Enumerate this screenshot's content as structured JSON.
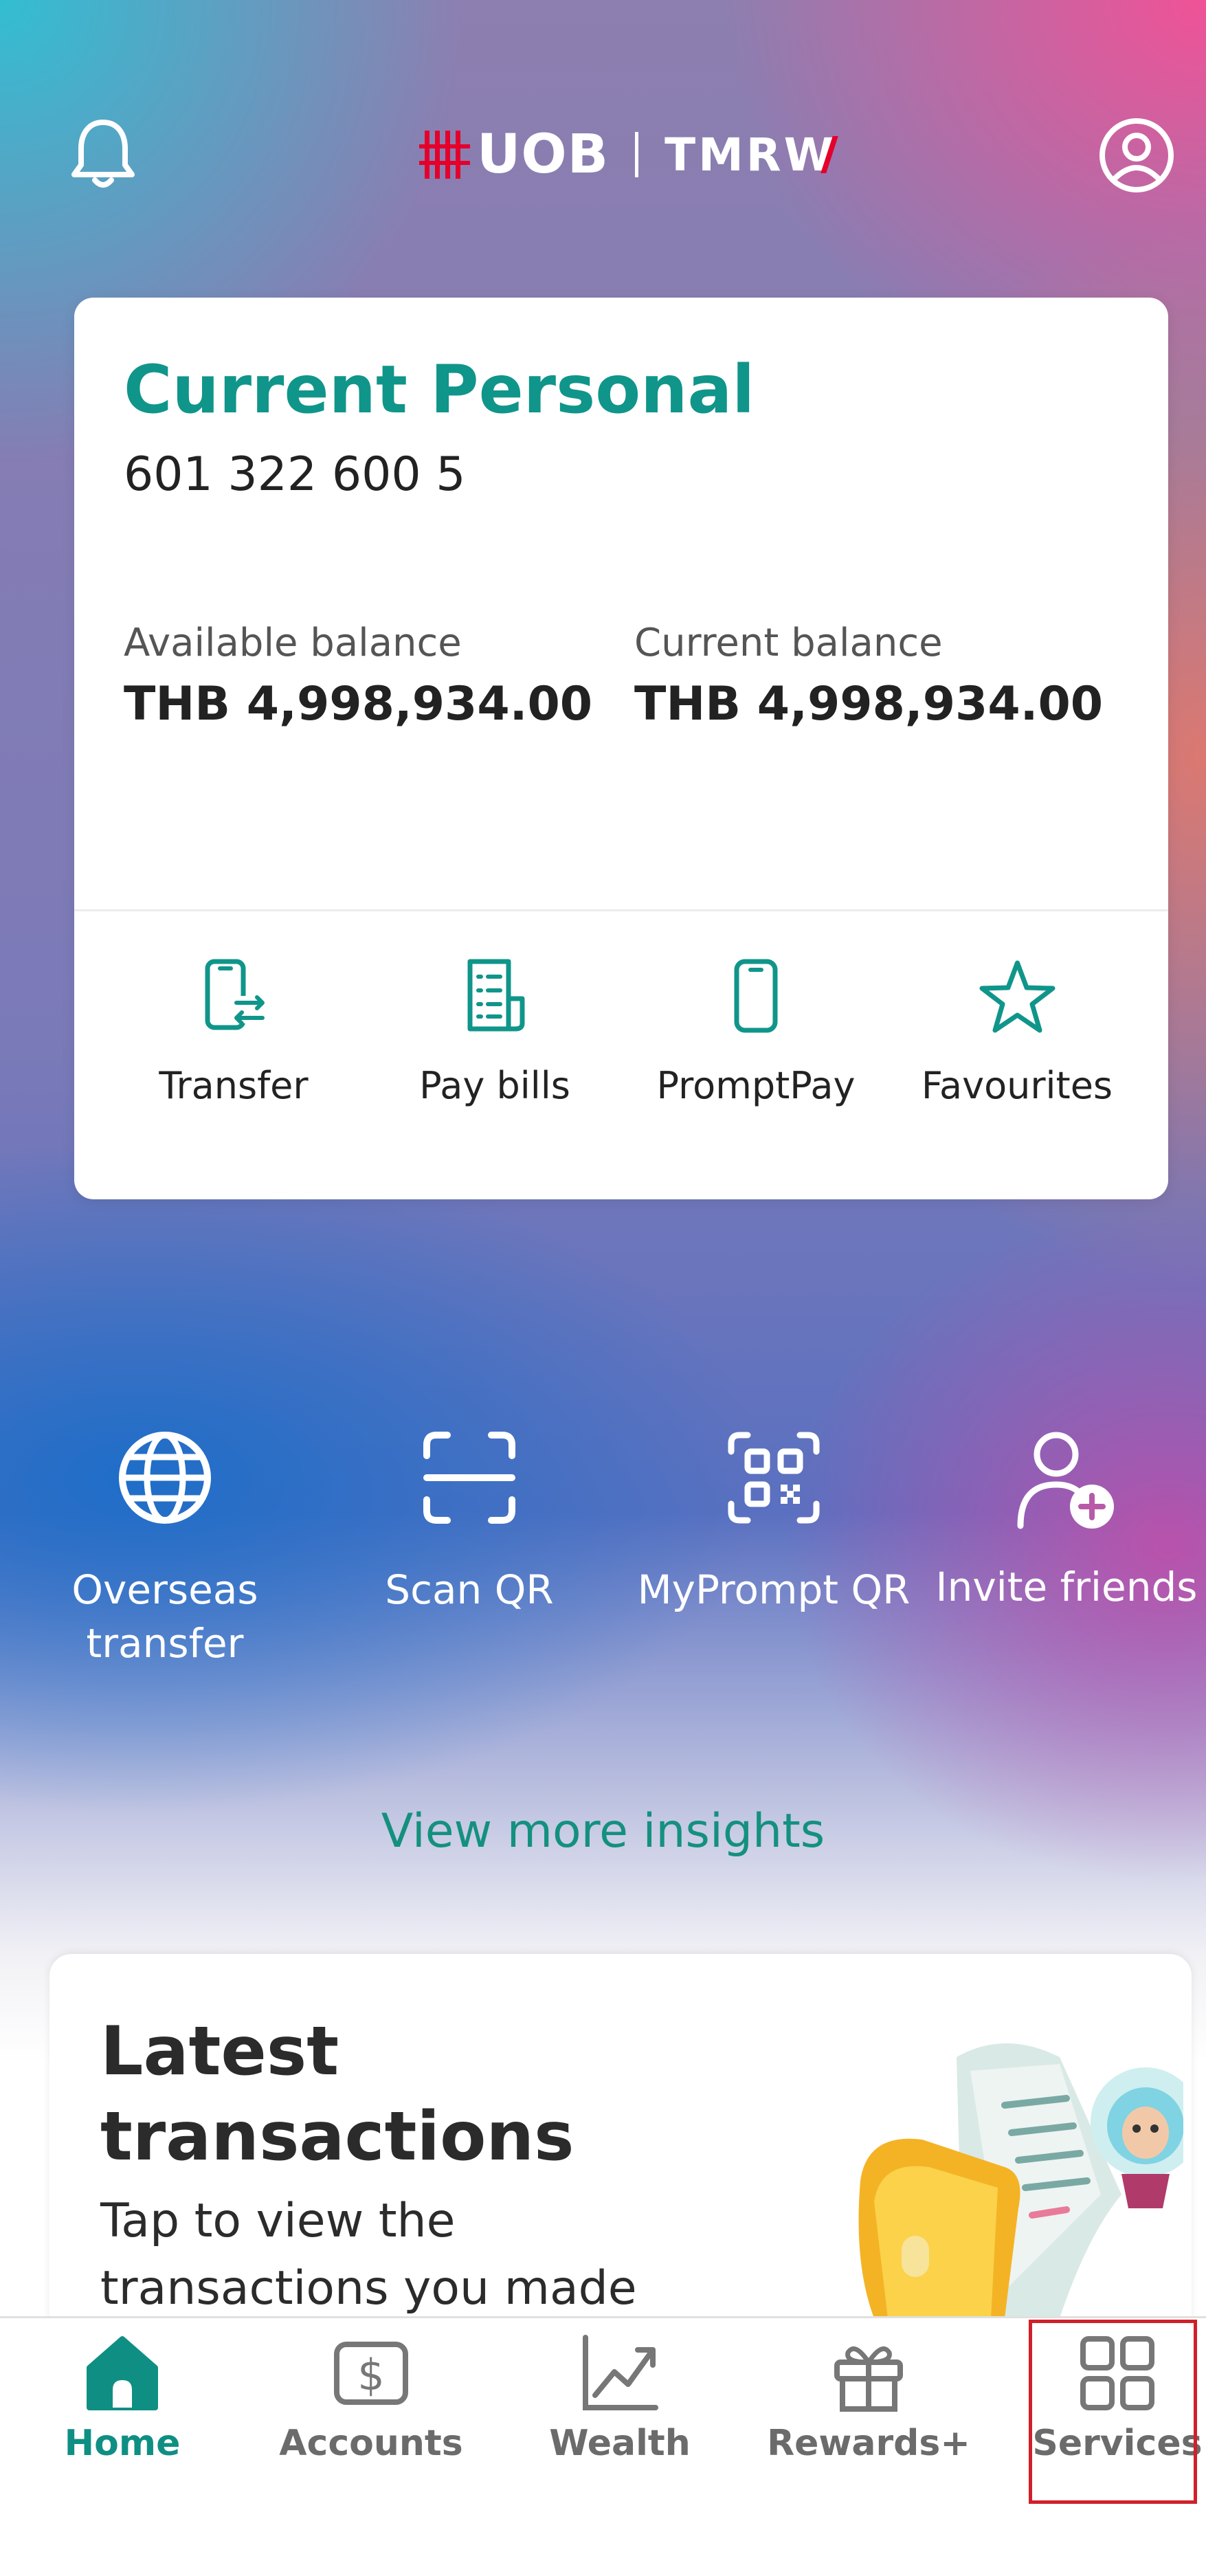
{
  "header": {
    "brand_primary": "UOB",
    "brand_secondary": "TMRW",
    "icons": [
      "bell-icon",
      "profile-icon"
    ]
  },
  "account_card": {
    "title": "Current Personal",
    "account_number": "601 322 600 5",
    "available_label": "Available balance",
    "available_value": "THB 4,998,934.00",
    "current_label": "Current balance",
    "current_value": "THB 4,998,934.00",
    "actions": [
      {
        "label": "Transfer",
        "icon": "phone-transfer-icon"
      },
      {
        "label": "Pay bills",
        "icon": "receipt-icon"
      },
      {
        "label": "PromptPay",
        "icon": "mobile-phone-icon"
      },
      {
        "label": "Favourites",
        "icon": "star-icon"
      }
    ]
  },
  "quick_actions": [
    {
      "label": "Overseas transfer",
      "icon": "globe-icon"
    },
    {
      "label": "Scan QR",
      "icon": "scan-icon"
    },
    {
      "label": "MyPrompt QR",
      "icon": "qr-code-icon"
    },
    {
      "label": "Invite friends",
      "icon": "add-user-icon"
    }
  ],
  "insights_link": "View more insights",
  "latest_transactions": {
    "title_line1": "Latest",
    "title_line2": "transactions",
    "subtitle_line1": "Tap to view the",
    "subtitle_line2": "transactions you made"
  },
  "bottom_nav": [
    {
      "label": "Home",
      "icon": "home-icon",
      "active": true
    },
    {
      "label": "Accounts",
      "icon": "dollar-icon",
      "active": false
    },
    {
      "label": "Wealth",
      "icon": "chart-icon",
      "active": false
    },
    {
      "label": "Rewards+",
      "icon": "gift-icon",
      "active": false
    },
    {
      "label": "Services",
      "icon": "grid-icon",
      "active": false
    }
  ],
  "colors": {
    "accent": "#10958a",
    "brand_red": "#e4002b",
    "highlight_red": "#d0202a"
  }
}
